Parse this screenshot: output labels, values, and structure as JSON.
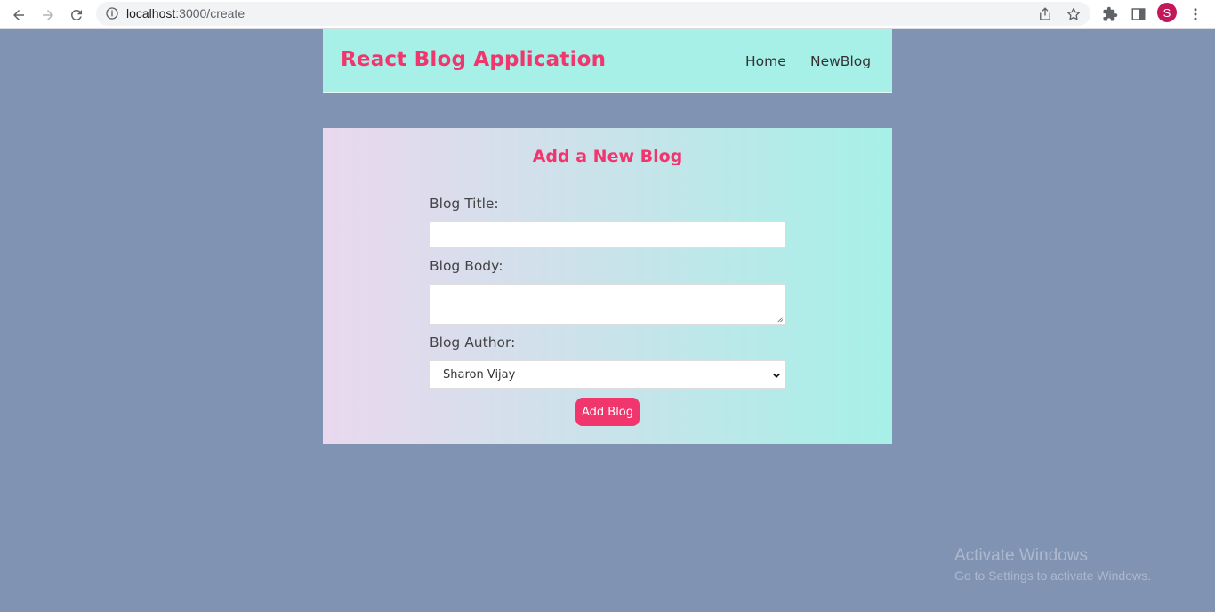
{
  "browser": {
    "url_host": "localhost",
    "url_path": ":3000/create",
    "profile_initial": "S"
  },
  "navbar": {
    "brand": "React Blog Application",
    "links": [
      "Home",
      "NewBlog"
    ]
  },
  "form": {
    "heading": "Add a New Blog",
    "title_label": "Blog Title:",
    "title_value": "",
    "body_label": "Blog Body:",
    "body_value": "",
    "author_label": "Blog Author:",
    "author_selected": "Sharon Vijay",
    "submit_label": "Add Blog"
  },
  "watermark": {
    "line1": "Activate Windows",
    "line2": "Go to Settings to activate Windows."
  },
  "colors": {
    "accent": "#f1356d",
    "navbar_bg": "#a6f0e8",
    "page_bg": "#8093b3"
  }
}
